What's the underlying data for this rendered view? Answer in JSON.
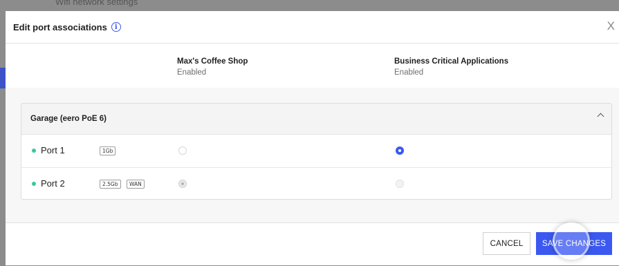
{
  "background": {
    "partial_text": "Wifi network settings"
  },
  "modal": {
    "title": "Edit port associations",
    "info_glyph": "i",
    "close_glyph": "X"
  },
  "networks": [
    {
      "name": "Max's Coffee Shop",
      "status": "Enabled"
    },
    {
      "name": "Business Critical Applications",
      "status": "Enabled"
    }
  ],
  "device": {
    "name": "Garage (eero PoE 6)",
    "ports": [
      {
        "label": "Port 1",
        "tags": [
          "1Gb"
        ],
        "network_1": "unselected",
        "network_2": "selected"
      },
      {
        "label": "Port 2",
        "tags": [
          "2.5Gb",
          "WAN"
        ],
        "network_1": "disabled",
        "network_2": "disabled"
      }
    ]
  },
  "footer": {
    "cancel_label": "CANCEL",
    "save_label": "SAVE CHANGES"
  },
  "colors": {
    "accent": "#3b59f0",
    "status_dot": "#35c9a0",
    "overlay": "#8c8c8c"
  }
}
